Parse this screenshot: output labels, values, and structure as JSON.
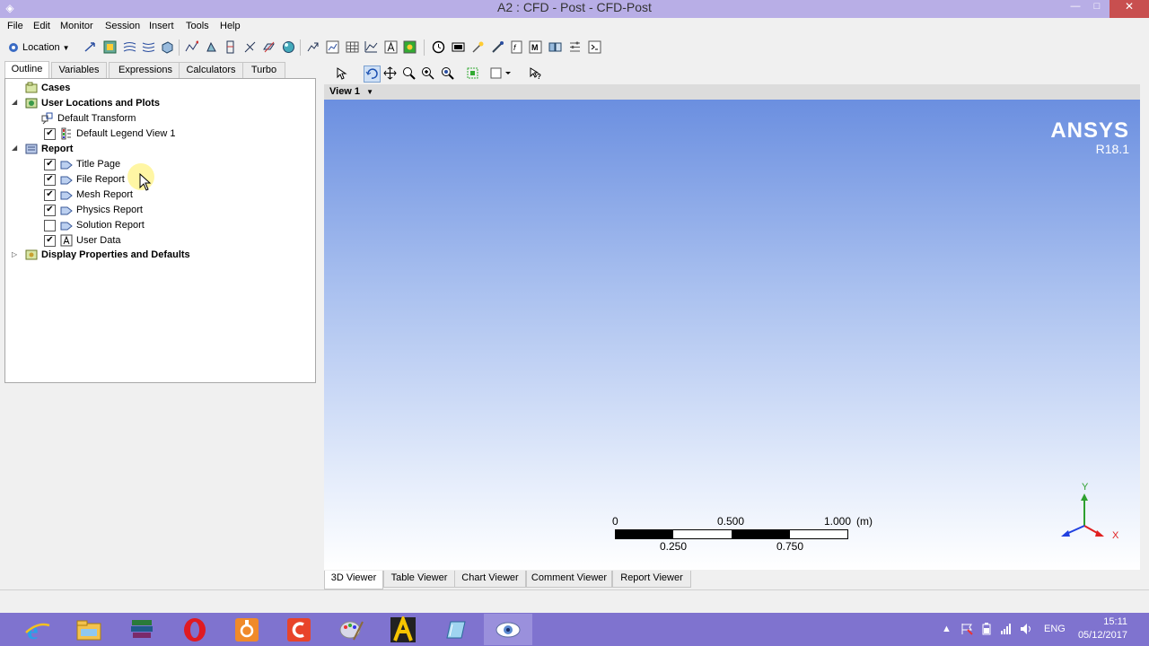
{
  "window": {
    "title": "A2 : CFD - Post - CFD-Post",
    "controls": {
      "minimize": "—",
      "maximize": "□",
      "close": "✕"
    }
  },
  "menu": [
    "File",
    "Edit",
    "Monitor",
    "Session",
    "Insert",
    "Tools",
    "Help"
  ],
  "toolbar": {
    "location_label": "Location",
    "icons": [
      "vector-icon",
      "contour-icon",
      "streamline-icon",
      "volume-rendering-icon",
      "isosurface-icon",
      "particle-track-icon",
      "volume-icon",
      "isoclip-icon",
      "vortex-core-icon",
      "surface-icon",
      "polyline-icon",
      "user-surface-icon",
      "surface-group-icon",
      "sphere-icon",
      "turbo-surface-icon",
      "chart-icon",
      "table-icon",
      "polyline-chart-icon",
      "text-icon",
      "legend-icon",
      "clock-icon",
      "instance-transform-icon",
      "light-icon",
      "color-pick-icon",
      "expression-icon",
      "mesh-icon",
      "coord-frame-icon",
      "command-icon"
    ]
  },
  "left_tabs": [
    "Outline",
    "Variables",
    "Expressions",
    "Calculators",
    "Turbo"
  ],
  "tree": {
    "cases": "Cases",
    "user_locations": "User Locations and Plots",
    "default_transform": "Default Transform",
    "default_legend": "Default Legend View 1",
    "report": "Report",
    "report_items": [
      {
        "label": "Title Page",
        "checked": true
      },
      {
        "label": "File Report",
        "checked": true
      },
      {
        "label": "Mesh Report",
        "checked": true
      },
      {
        "label": "Physics Report",
        "checked": true
      },
      {
        "label": "Solution Report",
        "checked": false
      },
      {
        "label": "User Data",
        "checked": true
      }
    ],
    "display_props": "Display Properties and Defaults"
  },
  "viewer": {
    "view_name": "View 1",
    "logo_name": "ANSYS",
    "logo_version": "R18.1",
    "scale": {
      "labels_top": [
        "0",
        "0.500",
        "1.000"
      ],
      "unit": "(m)",
      "labels_bottom": [
        "0.250",
        "0.750"
      ]
    },
    "axes": {
      "x": "X",
      "y": "Y"
    }
  },
  "bottom_tabs": [
    "3D Viewer",
    "Table Viewer",
    "Chart Viewer",
    "Comment Viewer",
    "Report Viewer"
  ],
  "taskbar": {
    "apps": [
      "internet-explorer-icon",
      "file-explorer-icon",
      "books-app-icon",
      "opera-icon",
      "orange-app-icon",
      "red-c-app-icon",
      "paint-app-icon",
      "ansys-app-icon",
      "blue-app-icon",
      "cfd-post-app-icon"
    ],
    "language": "ENG",
    "time": "15:11",
    "date": "05/12/2017"
  },
  "colors": {
    "titlebar": "#b8aee6",
    "taskbar": "#7f73cf",
    "viewport_top": "#6b8fe0"
  }
}
